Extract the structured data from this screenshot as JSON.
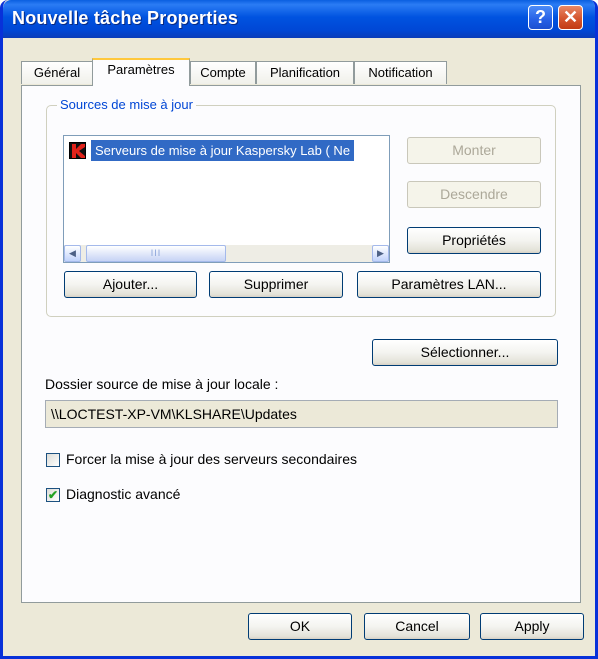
{
  "window": {
    "title": "Nouvelle tâche Properties",
    "help_glyph": "?",
    "close_glyph": "✕"
  },
  "tabs": [
    {
      "label": "Général",
      "active": false
    },
    {
      "label": "Paramètres",
      "active": true
    },
    {
      "label": "Compte",
      "active": false
    },
    {
      "label": "Planification",
      "active": false
    },
    {
      "label": "Notification",
      "active": false
    }
  ],
  "sources": {
    "group_label": "Sources de mise à jour",
    "items": [
      {
        "label": "Serveurs de mise à jour Kaspersky Lab ( Ne",
        "icon": "kaspersky-k-icon",
        "selected": true
      }
    ],
    "scrollbar": {
      "left_glyph": "◀",
      "thumb_glyph": "III",
      "right_glyph": "▶"
    },
    "buttons": {
      "move_up": "Monter",
      "move_down": "Descendre",
      "properties": "Propriétés",
      "add": "Ajouter...",
      "remove": "Supprimer",
      "lan_settings": "Paramètres LAN..."
    }
  },
  "local_source": {
    "select_button": "Sélectionner...",
    "label": "Dossier source de mise à jour locale :",
    "value": "\\\\LOCTEST-XP-VM\\KLSHARE\\Updates"
  },
  "options": [
    {
      "label": "Forcer la mise à jour des serveurs secondaires",
      "checked": false,
      "glyph": ""
    },
    {
      "label": "Diagnostic avancé",
      "checked": true,
      "glyph": "✔"
    }
  ],
  "footer": {
    "ok": "OK",
    "cancel": "Cancel",
    "apply": "Apply"
  },
  "colors": {
    "titlebar": "#0053e0",
    "selection": "#316ac5",
    "group_label": "#0046d5",
    "active_tab_accent": "#ffc83c",
    "kaspersky_red": "#e2231a"
  }
}
